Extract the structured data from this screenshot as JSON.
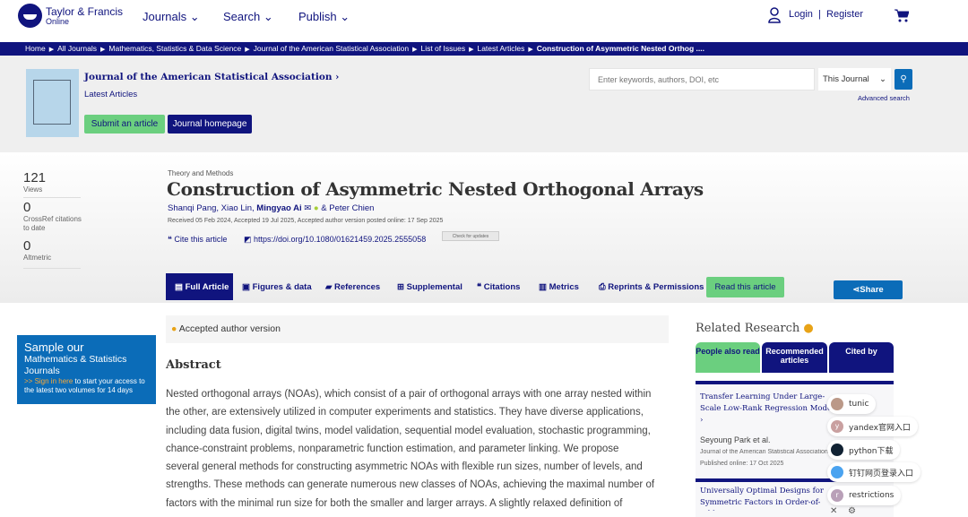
{
  "header": {
    "brand": "Taylor & Francis",
    "brand_sub": "Online",
    "nav": [
      "Journals",
      "Search",
      "Publish"
    ],
    "login": "Login",
    "register": "Register"
  },
  "breadcrumb": [
    "Home",
    "All Journals",
    "Mathematics, Statistics & Data Science",
    "Journal of the American Statistical Association",
    "List of Issues",
    "Latest Articles",
    "Construction of Asymmetric Nested Orthog ...."
  ],
  "journal": {
    "title": "Journal of the American Statistical Association",
    "subtitle": "Latest Articles",
    "submit": "Submit an article",
    "homepage": "Journal homepage"
  },
  "search": {
    "placeholder": "Enter keywords, authors, DOI, etc",
    "scope": "This Journal",
    "advanced": "Advanced search"
  },
  "metrics": [
    {
      "value": "121",
      "label": "Views"
    },
    {
      "value": "0",
      "label": "CrossRef citations to date"
    },
    {
      "value": "0",
      "label": "Altmetric"
    }
  ],
  "article": {
    "section": "Theory and Methods",
    "title": "Construction of Asymmetric Nested Orthogonal Arrays",
    "authors_plain": "Shanqi Pang, Xiao Lin,",
    "author_corr": "Mingyao Ai",
    "author_last": "& Peter Chien",
    "dates": "Received 05 Feb 2024, Accepted 19 Jul 2025, Accepted author version posted online: 17 Sep 2025",
    "cite": "Cite this article",
    "doi": "https://doi.org/10.1080/01621459.2025.2555058",
    "check": "Check for updates"
  },
  "tabs": [
    "Full Article",
    "Figures & data",
    "References",
    "Supplemental",
    "Citations",
    "Metrics",
    "Reprints & Permissions"
  ],
  "read_button": "Read this article",
  "share": "Share",
  "notice": "Accepted author version",
  "abstract": {
    "heading": "Abstract",
    "lines": [
      "Nested orthogonal arrays (NOAs), which consist of a pair of orthogonal arrays with one array nested within",
      "the other, are extensively utilized in computer experiments and statistics. They have diverse applications,",
      "including data fusion, digital twins, model validation, sequential model evaluation, stochastic programming,",
      "chance-constraint problems, nonparametric function estimation, and parameter linking. We propose",
      "several general methods for constructing asymmetric NOAs with flexible run sizes, number of levels, and",
      "strengths. These methods can generate numerous new classes of NOAs, achieving the maximal number of",
      "factors with the minimal run size for both the smaller and larger arrays. A slightly relaxed definition of"
    ]
  },
  "promo": {
    "title": "Sample our",
    "subtitle": "Mathematics & Statistics Journals",
    "link": ">> Sign in here",
    "rest": "to start your access to the latest two volumes for 14 days"
  },
  "related": {
    "heading": "Related Research",
    "tabs": [
      "People also read",
      "Recommended articles",
      "Cited by"
    ],
    "items": [
      {
        "title": "Transfer Learning Under Large-Scale Low-Rank Regression Models",
        "authors": "Seyoung Park et al.",
        "journal": "Journal of the American Statistical Association",
        "published": "Published online: 17 Oct 2025"
      },
      {
        "title": "Universally Optimal Designs for Symmetric Factors in Order-of-Addition Experiments"
      }
    ]
  },
  "popup": [
    "tunic",
    "yandex官网入口",
    "python下载",
    "钉钉网页登录入口",
    "restrictions"
  ]
}
